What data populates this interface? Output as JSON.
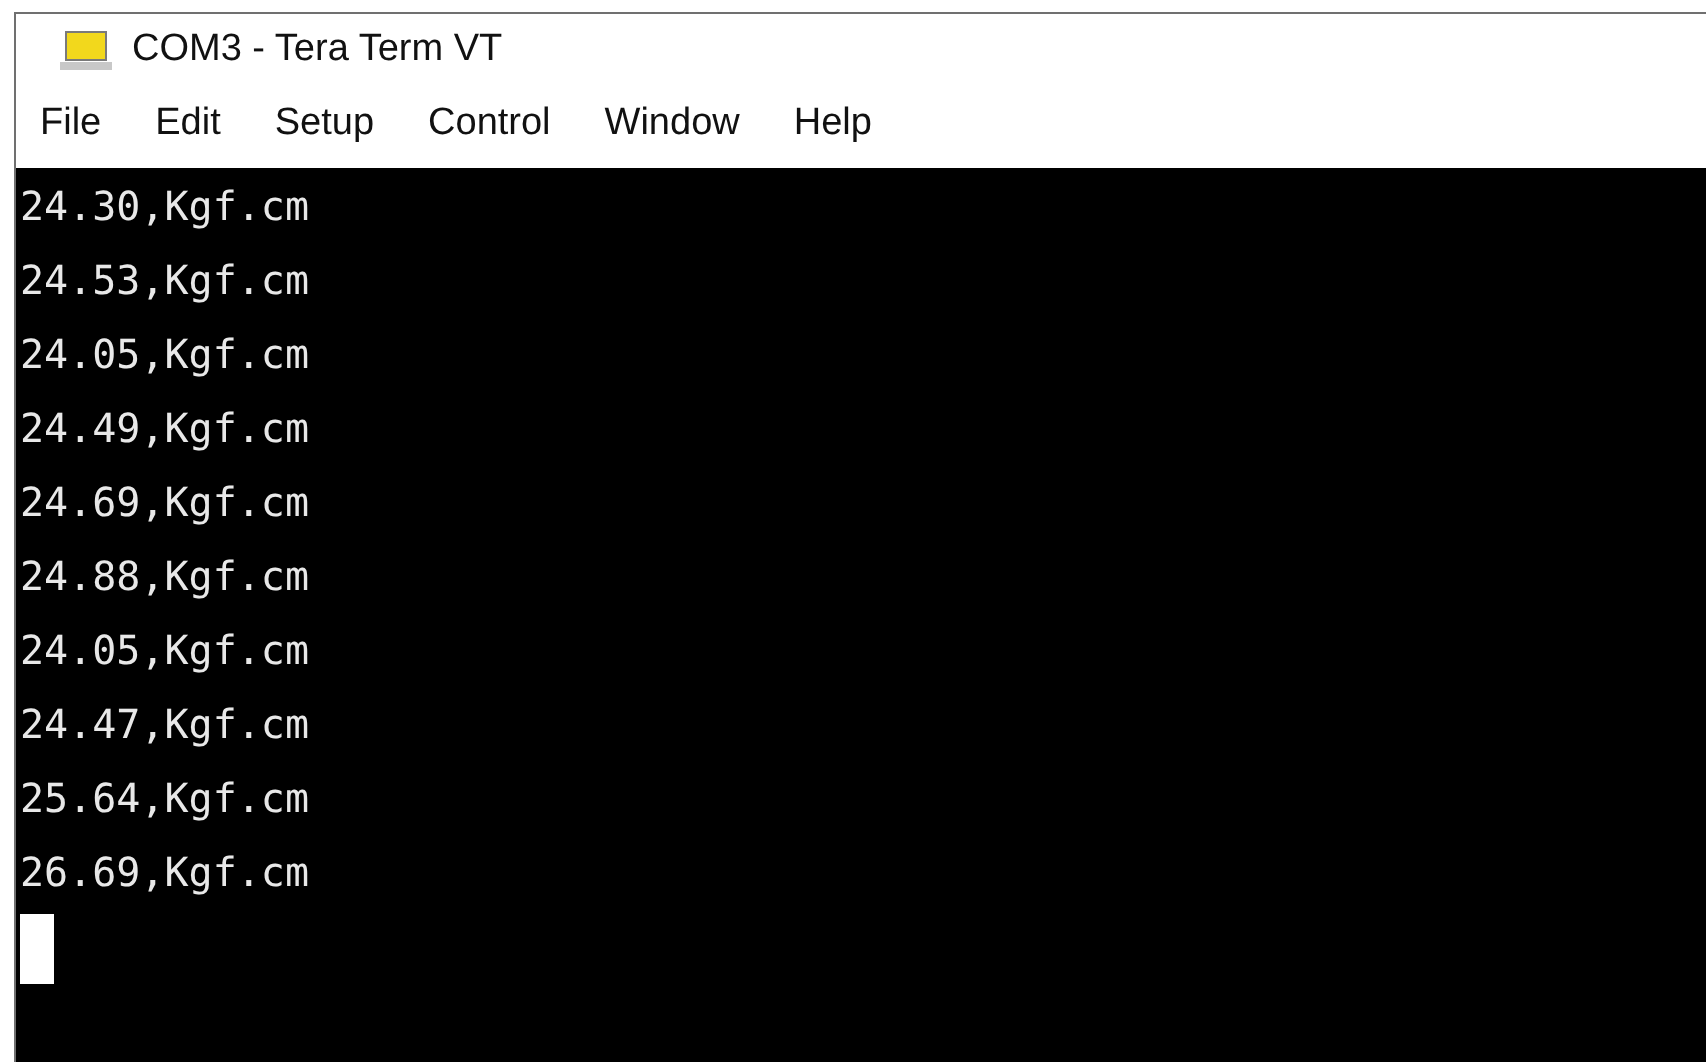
{
  "window": {
    "title": "COM3 - Tera Term VT"
  },
  "menu": [
    "File",
    "Edit",
    "Setup",
    "Control",
    "Window",
    "Help"
  ],
  "terminal": {
    "lines": [
      "24.30,Kgf.cm",
      "24.53,Kgf.cm",
      "24.05,Kgf.cm",
      "24.49,Kgf.cm",
      "24.69,Kgf.cm",
      "24.88,Kgf.cm",
      "24.05,Kgf.cm",
      "24.47,Kgf.cm",
      "25.64,Kgf.cm",
      "26.69,Kgf.cm"
    ],
    "cursor": true
  }
}
